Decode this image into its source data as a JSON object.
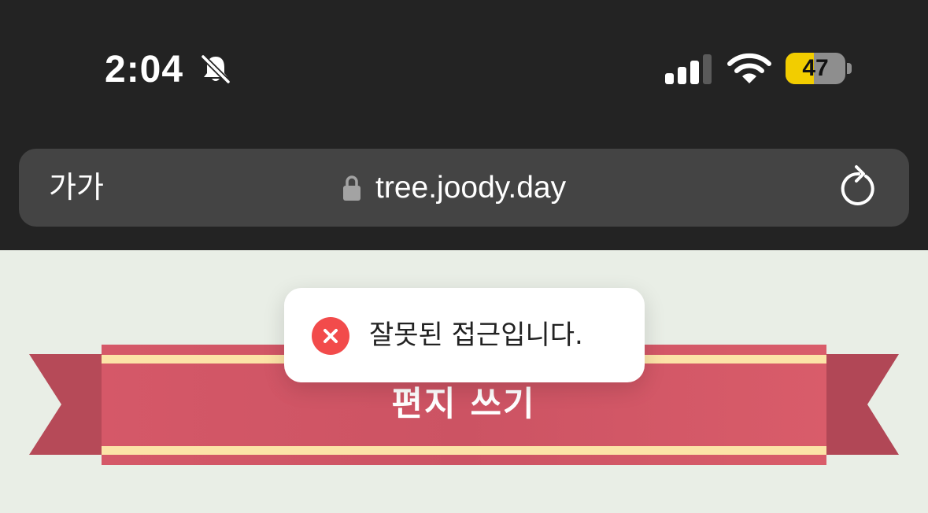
{
  "status_bar": {
    "time": "2:04",
    "battery_level": "47",
    "battery_fraction": 0.47,
    "icons": [
      "bell-off-icon",
      "cellular-signal-icon",
      "wifi-icon",
      "battery-icon"
    ]
  },
  "browser": {
    "text_size_button": "가가",
    "url": "tree.joody.day",
    "icons": [
      "lock-icon",
      "reload-icon"
    ]
  },
  "page": {
    "ribbon_title": "편지 쓰기"
  },
  "toast": {
    "message": "잘못된 접근입니다.",
    "icon": "error-icon"
  },
  "colors": {
    "chrome_background": "#232323",
    "address_bar": "#444444",
    "page_background": "#e9eee6",
    "ribbon_red": "#d85a68",
    "ribbon_stripe": "#fce3a7",
    "error_red": "#f24b4b",
    "battery_yellow": "#f2cd00"
  }
}
